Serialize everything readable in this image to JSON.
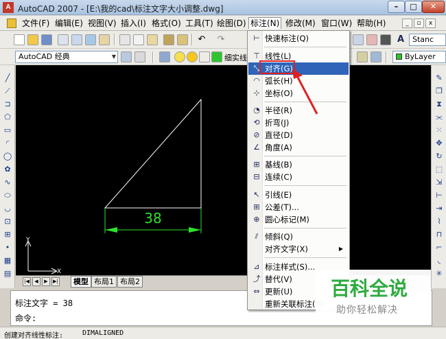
{
  "window": {
    "title": "AutoCAD 2007 - [E:\\我的cad\\标注文字大小调整.dwg]",
    "app_icon_glyph": "A",
    "controls": {
      "minimize": "–",
      "maximize": "□",
      "close": "✕"
    }
  },
  "menubar": {
    "items": [
      {
        "label": "文件(F)"
      },
      {
        "label": "编辑(E)"
      },
      {
        "label": "视图(V)"
      },
      {
        "label": "插入(I)"
      },
      {
        "label": "格式(O)"
      },
      {
        "label": "工具(T)"
      },
      {
        "label": "绘图(D)"
      },
      {
        "label": "标注(N)"
      },
      {
        "label": "修改(M)"
      },
      {
        "label": "窗口(W)"
      },
      {
        "label": "帮助(H)"
      }
    ],
    "active": "标注(N)",
    "mdi_controls": [
      "_",
      "▫",
      "x"
    ]
  },
  "toolbar1": {
    "style_combo": "Stanc"
  },
  "toolbar2": {
    "workspace_combo": "AutoCAD 经典",
    "layer_text": "细实线",
    "lineweight_combo": "ByLayer"
  },
  "drawing": {
    "dimension_text": "38",
    "ucs_x": "X",
    "ucs_y": "Y",
    "line_color": "#ffffff",
    "dimension_color": "#2ee02e"
  },
  "layout_tabs": {
    "nav": [
      "|◀",
      "◀",
      "▶",
      "▶|"
    ],
    "tabs": [
      {
        "label": "模型",
        "active": true
      },
      {
        "label": "布局1",
        "active": false
      },
      {
        "label": "布局2",
        "active": false
      }
    ]
  },
  "command": {
    "line1": "标注文字 = 38",
    "line2": "命令:"
  },
  "status": {
    "label": "创建对齐线性标注:",
    "command": "DIMALIGNED"
  },
  "dim_menu": {
    "items": [
      {
        "label": "快速标注(Q)",
        "icon": "quick-dim-icon",
        "glyph": "⊢"
      },
      {
        "label": "线性(L)",
        "icon": "linear-dim-icon",
        "glyph": "⊤"
      },
      {
        "label": "对齐(G)",
        "icon": "aligned-dim-icon",
        "glyph": "⤡",
        "highlight": true
      },
      {
        "label": "弧长(H)",
        "icon": "arc-length-icon",
        "glyph": "◠"
      },
      {
        "label": "坐标(O)",
        "icon": "ordinate-icon",
        "glyph": "⊹"
      },
      {
        "label": "半径(R)",
        "icon": "radius-icon",
        "glyph": "◔"
      },
      {
        "label": "折弯(J)",
        "icon": "jogged-icon",
        "glyph": "⟲"
      },
      {
        "label": "直径(D)",
        "icon": "diameter-icon",
        "glyph": "⊘"
      },
      {
        "label": "角度(A)",
        "icon": "angular-icon",
        "glyph": "∠"
      },
      {
        "label": "基线(B)",
        "icon": "baseline-icon",
        "glyph": "⊞"
      },
      {
        "label": "连续(C)",
        "icon": "continue-icon",
        "glyph": "⊟"
      },
      {
        "label": "引线(E)",
        "icon": "leader-icon",
        "glyph": "↖"
      },
      {
        "label": "公差(T)...",
        "icon": "tolerance-icon",
        "glyph": "⊞"
      },
      {
        "label": "圆心标记(M)",
        "icon": "center-mark-icon",
        "glyph": "⊕"
      },
      {
        "label": "倾斜(Q)",
        "icon": "oblique-icon",
        "glyph": "⫽"
      },
      {
        "label": "对齐文字(X)",
        "icon": "",
        "glyph": "",
        "submenu": true
      },
      {
        "label": "标注样式(S)...",
        "icon": "dim-style-icon",
        "glyph": "⊿"
      },
      {
        "label": "替代(V)",
        "icon": "override-icon",
        "glyph": "⤴"
      },
      {
        "label": "更新(U)",
        "icon": "update-icon",
        "glyph": "⇔"
      },
      {
        "label": "重新关联标注(N)",
        "icon": "",
        "glyph": ""
      }
    ]
  },
  "watermark": {
    "title": "百科全说",
    "subtitle": "助你轻松解决"
  },
  "colors": {
    "highlight": "#2f64b8",
    "annotation_red": "#e02020",
    "canvas": "#000000"
  }
}
